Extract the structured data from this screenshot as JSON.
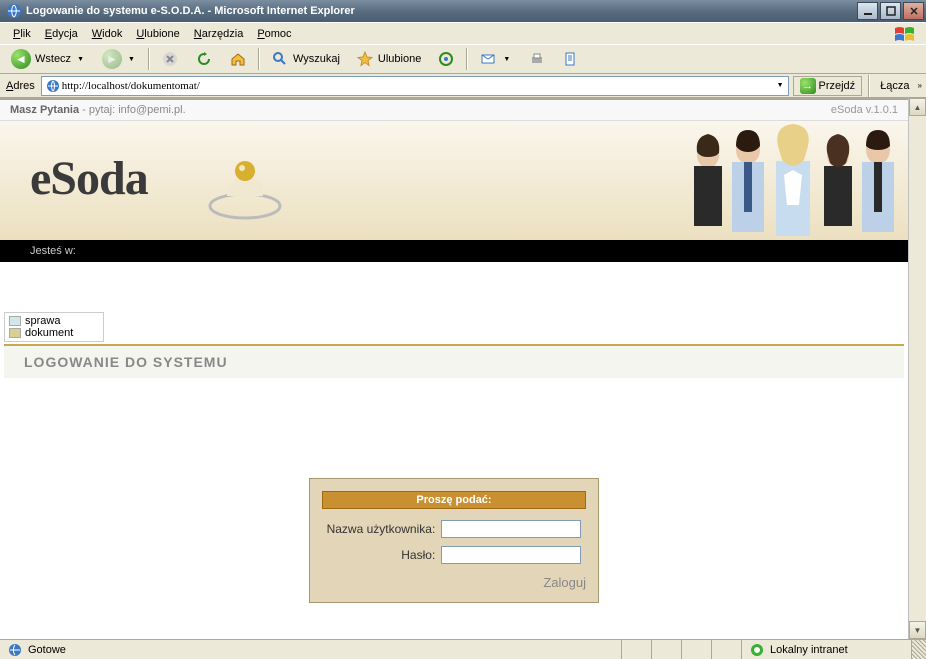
{
  "window": {
    "title": "Logowanie do systemu e-S.O.D.A. - Microsoft Internet Explorer"
  },
  "menu": {
    "file": "Plik",
    "edit": "Edycja",
    "view": "Widok",
    "favorites": "Ulubione",
    "tools": "Narzędzia",
    "help": "Pomoc"
  },
  "toolbar": {
    "back": "Wstecz",
    "search": "Wyszukaj",
    "favorites": "Ulubione"
  },
  "address": {
    "label": "Adres",
    "url": "http://localhost/dokumentomat/",
    "go": "Przejdź",
    "links": "Łącza"
  },
  "page": {
    "hint_bold": "Masz Pytania",
    "hint_rest": " - pytaj: info@pemi.pl.",
    "version": "eSoda v.1.0.1",
    "logo": "eSoda",
    "breadcrumb_label": "Jesteś w:",
    "legend": {
      "a": "sprawa",
      "b": "dokument"
    },
    "section_title": "LOGOWANIE DO SYSTEMU",
    "login": {
      "header": "Proszę podać:",
      "user_label": "Nazwa użytkownika:",
      "pass_label": "Hasło:",
      "submit": "Zaloguj"
    }
  },
  "status": {
    "ready": "Gotowe",
    "zone": "Lokalny intranet"
  }
}
